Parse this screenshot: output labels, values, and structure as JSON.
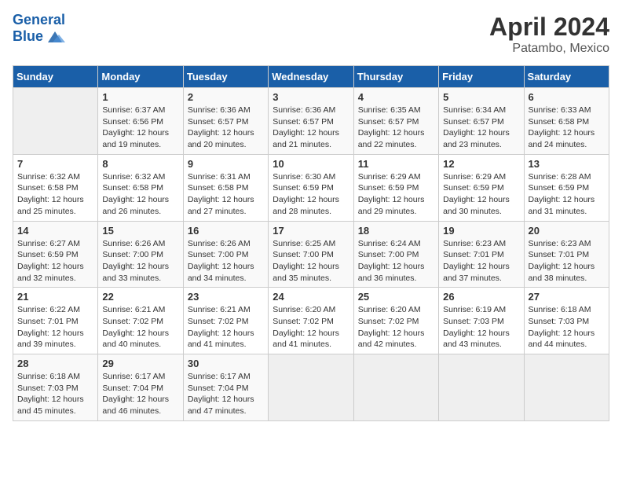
{
  "header": {
    "logo_line1": "General",
    "logo_line2": "Blue",
    "title": "April 2024",
    "subtitle": "Patambo, Mexico"
  },
  "columns": [
    "Sunday",
    "Monday",
    "Tuesday",
    "Wednesday",
    "Thursday",
    "Friday",
    "Saturday"
  ],
  "weeks": [
    [
      {
        "num": "",
        "info": ""
      },
      {
        "num": "1",
        "info": "Sunrise: 6:37 AM\nSunset: 6:56 PM\nDaylight: 12 hours\nand 19 minutes."
      },
      {
        "num": "2",
        "info": "Sunrise: 6:36 AM\nSunset: 6:57 PM\nDaylight: 12 hours\nand 20 minutes."
      },
      {
        "num": "3",
        "info": "Sunrise: 6:36 AM\nSunset: 6:57 PM\nDaylight: 12 hours\nand 21 minutes."
      },
      {
        "num": "4",
        "info": "Sunrise: 6:35 AM\nSunset: 6:57 PM\nDaylight: 12 hours\nand 22 minutes."
      },
      {
        "num": "5",
        "info": "Sunrise: 6:34 AM\nSunset: 6:57 PM\nDaylight: 12 hours\nand 23 minutes."
      },
      {
        "num": "6",
        "info": "Sunrise: 6:33 AM\nSunset: 6:58 PM\nDaylight: 12 hours\nand 24 minutes."
      }
    ],
    [
      {
        "num": "7",
        "info": "Sunrise: 6:32 AM\nSunset: 6:58 PM\nDaylight: 12 hours\nand 25 minutes."
      },
      {
        "num": "8",
        "info": "Sunrise: 6:32 AM\nSunset: 6:58 PM\nDaylight: 12 hours\nand 26 minutes."
      },
      {
        "num": "9",
        "info": "Sunrise: 6:31 AM\nSunset: 6:58 PM\nDaylight: 12 hours\nand 27 minutes."
      },
      {
        "num": "10",
        "info": "Sunrise: 6:30 AM\nSunset: 6:59 PM\nDaylight: 12 hours\nand 28 minutes."
      },
      {
        "num": "11",
        "info": "Sunrise: 6:29 AM\nSunset: 6:59 PM\nDaylight: 12 hours\nand 29 minutes."
      },
      {
        "num": "12",
        "info": "Sunrise: 6:29 AM\nSunset: 6:59 PM\nDaylight: 12 hours\nand 30 minutes."
      },
      {
        "num": "13",
        "info": "Sunrise: 6:28 AM\nSunset: 6:59 PM\nDaylight: 12 hours\nand 31 minutes."
      }
    ],
    [
      {
        "num": "14",
        "info": "Sunrise: 6:27 AM\nSunset: 6:59 PM\nDaylight: 12 hours\nand 32 minutes."
      },
      {
        "num": "15",
        "info": "Sunrise: 6:26 AM\nSunset: 7:00 PM\nDaylight: 12 hours\nand 33 minutes."
      },
      {
        "num": "16",
        "info": "Sunrise: 6:26 AM\nSunset: 7:00 PM\nDaylight: 12 hours\nand 34 minutes."
      },
      {
        "num": "17",
        "info": "Sunrise: 6:25 AM\nSunset: 7:00 PM\nDaylight: 12 hours\nand 35 minutes."
      },
      {
        "num": "18",
        "info": "Sunrise: 6:24 AM\nSunset: 7:00 PM\nDaylight: 12 hours\nand 36 minutes."
      },
      {
        "num": "19",
        "info": "Sunrise: 6:23 AM\nSunset: 7:01 PM\nDaylight: 12 hours\nand 37 minutes."
      },
      {
        "num": "20",
        "info": "Sunrise: 6:23 AM\nSunset: 7:01 PM\nDaylight: 12 hours\nand 38 minutes."
      }
    ],
    [
      {
        "num": "21",
        "info": "Sunrise: 6:22 AM\nSunset: 7:01 PM\nDaylight: 12 hours\nand 39 minutes."
      },
      {
        "num": "22",
        "info": "Sunrise: 6:21 AM\nSunset: 7:02 PM\nDaylight: 12 hours\nand 40 minutes."
      },
      {
        "num": "23",
        "info": "Sunrise: 6:21 AM\nSunset: 7:02 PM\nDaylight: 12 hours\nand 41 minutes."
      },
      {
        "num": "24",
        "info": "Sunrise: 6:20 AM\nSunset: 7:02 PM\nDaylight: 12 hours\nand 41 minutes."
      },
      {
        "num": "25",
        "info": "Sunrise: 6:20 AM\nSunset: 7:02 PM\nDaylight: 12 hours\nand 42 minutes."
      },
      {
        "num": "26",
        "info": "Sunrise: 6:19 AM\nSunset: 7:03 PM\nDaylight: 12 hours\nand 43 minutes."
      },
      {
        "num": "27",
        "info": "Sunrise: 6:18 AM\nSunset: 7:03 PM\nDaylight: 12 hours\nand 44 minutes."
      }
    ],
    [
      {
        "num": "28",
        "info": "Sunrise: 6:18 AM\nSunset: 7:03 PM\nDaylight: 12 hours\nand 45 minutes."
      },
      {
        "num": "29",
        "info": "Sunrise: 6:17 AM\nSunset: 7:04 PM\nDaylight: 12 hours\nand 46 minutes."
      },
      {
        "num": "30",
        "info": "Sunrise: 6:17 AM\nSunset: 7:04 PM\nDaylight: 12 hours\nand 47 minutes."
      },
      {
        "num": "",
        "info": ""
      },
      {
        "num": "",
        "info": ""
      },
      {
        "num": "",
        "info": ""
      },
      {
        "num": "",
        "info": ""
      }
    ]
  ]
}
